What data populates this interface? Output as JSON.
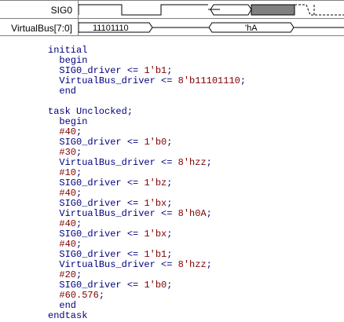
{
  "waveform": {
    "signals": [
      {
        "name": "SIG0"
      },
      {
        "name": "VirtualBus[7:0]",
        "values": [
          "11101110",
          "'hA"
        ]
      }
    ]
  },
  "code": {
    "lines": [
      {
        "indent": "",
        "text": "initial",
        "value": "",
        "suffix": ""
      },
      {
        "indent": "  ",
        "text": "begin",
        "value": "",
        "suffix": ""
      },
      {
        "indent": "  ",
        "text": "SIG0_driver <= ",
        "value": "1'b1",
        "suffix": ";"
      },
      {
        "indent": "  ",
        "text": "VirtualBus_driver <= ",
        "value": "8'b11101110",
        "suffix": ";"
      },
      {
        "indent": "  ",
        "text": "end",
        "value": "",
        "suffix": ""
      },
      {
        "indent": "",
        "text": "",
        "value": "",
        "suffix": ""
      },
      {
        "indent": "",
        "text": "task Unclocked;",
        "value": "",
        "suffix": ""
      },
      {
        "indent": "  ",
        "text": "begin",
        "value": "",
        "suffix": ""
      },
      {
        "indent": "  ",
        "text": "",
        "value": "#40",
        "suffix": ";"
      },
      {
        "indent": "  ",
        "text": "SIG0_driver <= ",
        "value": "1'b0",
        "suffix": ";"
      },
      {
        "indent": "  ",
        "text": "",
        "value": "#30",
        "suffix": ";"
      },
      {
        "indent": "  ",
        "text": "VirtualBus_driver <= ",
        "value": "8'hzz",
        "suffix": ";"
      },
      {
        "indent": "  ",
        "text": "",
        "value": "#10",
        "suffix": ";"
      },
      {
        "indent": "  ",
        "text": "SIG0_driver <= ",
        "value": "1'bz",
        "suffix": ";"
      },
      {
        "indent": "  ",
        "text": "",
        "value": "#40",
        "suffix": ";"
      },
      {
        "indent": "  ",
        "text": "SIG0_driver <= ",
        "value": "1'bx",
        "suffix": ";"
      },
      {
        "indent": "  ",
        "text": "VirtualBus_driver <= ",
        "value": "8'h0A",
        "suffix": ";"
      },
      {
        "indent": "  ",
        "text": "",
        "value": "#40",
        "suffix": ";"
      },
      {
        "indent": "  ",
        "text": "SIG0_driver <= ",
        "value": "1'bx",
        "suffix": ";"
      },
      {
        "indent": "  ",
        "text": "",
        "value": "#40",
        "suffix": ";"
      },
      {
        "indent": "  ",
        "text": "SIG0_driver <= ",
        "value": "1'b1",
        "suffix": ";"
      },
      {
        "indent": "  ",
        "text": "VirtualBus_driver <= ",
        "value": "8'hzz",
        "suffix": ";"
      },
      {
        "indent": "  ",
        "text": "",
        "value": "#20",
        "suffix": ";"
      },
      {
        "indent": "  ",
        "text": "SIG0_driver <= ",
        "value": "1'b0",
        "suffix": ";"
      },
      {
        "indent": "  ",
        "text": "",
        "value": "#60.576",
        "suffix": ";"
      },
      {
        "indent": "  ",
        "text": "end",
        "value": "",
        "suffix": ""
      },
      {
        "indent": "",
        "text": "endtask",
        "value": "",
        "suffix": ""
      }
    ]
  },
  "colors": {
    "code_text": "#000080",
    "code_value": "#800000",
    "waveform_fill_unknown": "#808080"
  }
}
